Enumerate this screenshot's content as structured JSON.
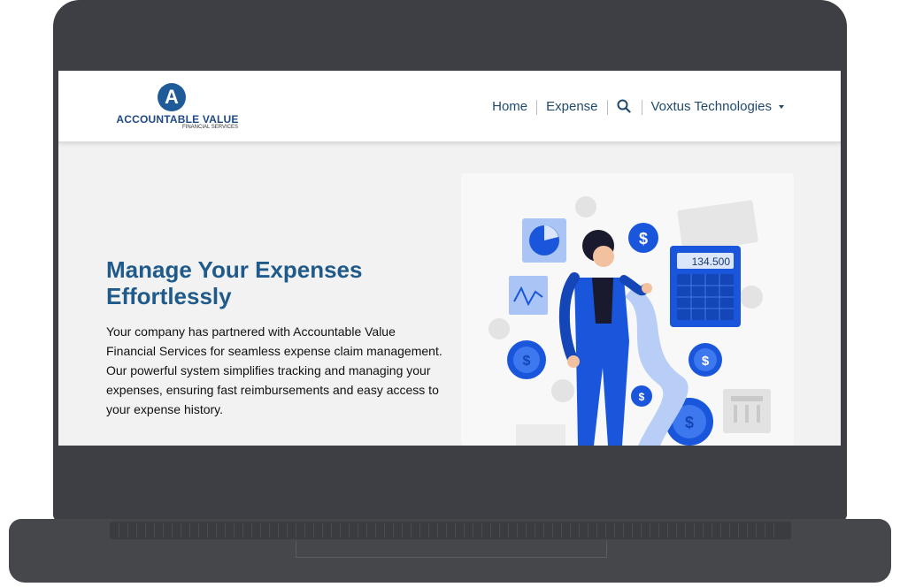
{
  "brand": {
    "name": "ACCOUNTABLE VALUE",
    "tagline": "FINANCIAL SERVICES",
    "logo_letter": "A",
    "color": "#1f5a99"
  },
  "nav": {
    "home": "Home",
    "expense": "Expense",
    "company": "Voxtus Technologies"
  },
  "hero": {
    "title": "Manage Your Expenses Effortlessly",
    "text": "Your company has partnered with Accountable Value Financial Services for seamless expense claim management. Our powerful system simplifies tracking and managing your expenses, ensuring fast reimbursements and easy access to your expense history."
  },
  "illustration": {
    "calculator_display": "134.500",
    "accent_color": "#1a56db"
  },
  "colors": {
    "frame": "#3d3f44",
    "title": "#1f5a8a",
    "nav_text": "#1f4a6e"
  }
}
